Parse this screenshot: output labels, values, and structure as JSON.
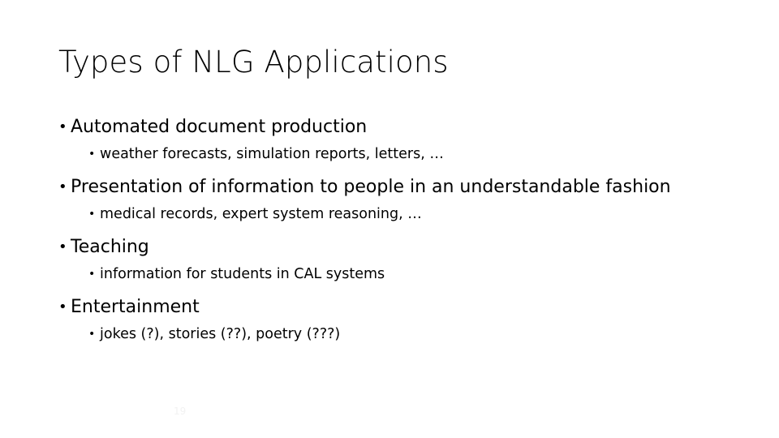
{
  "slide": {
    "title": "Types of NLG Applications",
    "bullet_char": "•",
    "text_color": "#000000",
    "background_color": "#ffffff",
    "page_number": "19",
    "page_number_color": "#f2f2f2",
    "items": [
      {
        "level1": "Automated document production",
        "level2": "weather forecasts, simulation reports, letters, …"
      },
      {
        "level1": "Presentation of information to people in an understandable fashion",
        "level2": "medical records, expert system reasoning, …"
      },
      {
        "level1": "Teaching",
        "level2": "information for students in CAL systems"
      },
      {
        "level1": "Entertainment",
        "level2": "jokes (?), stories (??), poetry (???)"
      }
    ]
  }
}
